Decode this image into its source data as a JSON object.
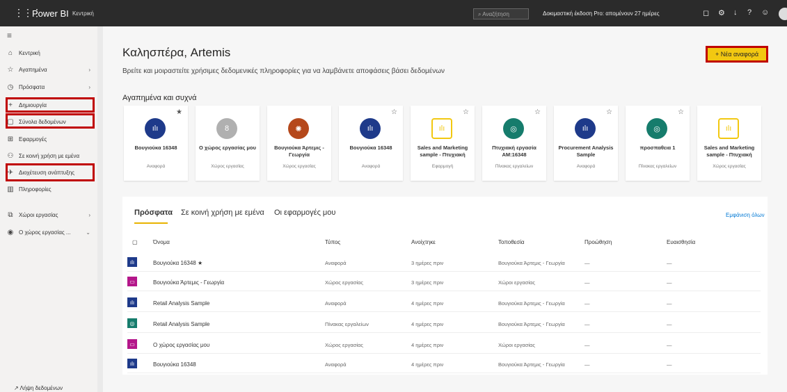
{
  "topbar": {
    "brand": "Power BI",
    "breadcrumb": "Κεντρική",
    "search_placeholder": "Αναζήτηση",
    "trial": "Δοκιμαστική έκδοση Pro: απομένουν 27 ημέρες"
  },
  "sidebar": {
    "items": [
      {
        "label": "Κεντρική"
      },
      {
        "label": "Αγαπημένα"
      },
      {
        "label": "Πρόσφατα"
      },
      {
        "label": "Δημιουργία"
      },
      {
        "label": "Σύνολα δεδομένων"
      },
      {
        "label": "Εφαρμογές"
      },
      {
        "label": "Σε κοινή χρήση με εμένα"
      },
      {
        "label": "Διοχέτευση ανάπτυξης"
      },
      {
        "label": "Πληροφορίες"
      },
      {
        "label": "Χώροι εργασίας"
      },
      {
        "label": "Ο χώρος εργασίας ..."
      }
    ],
    "footer": "Λήψη δεδομένων"
  },
  "main": {
    "greeting": "Καλησπέρα, Artemis",
    "subtitle": "Βρείτε και μοιραστείτε χρήσιμες δεδομενικές πληροφορίες για να λαμβάνετε αποφάσεις βάσει δεδομένων",
    "new_report": "Νέα αναφορά",
    "favorites_title": "Αγαπημένα και συχνά",
    "cards": [
      {
        "title": "Βουγιούκα 16348",
        "type": "Αναφορά",
        "color": "#1e3a8a"
      },
      {
        "title": "Ο χώρος εργασίας μου",
        "type": "Χώρος εργασίας",
        "color": "#b0b0b0"
      },
      {
        "title": "Βουγιούκα Άρτεμις - Γεωργία",
        "type": "Χώρος εργασίας",
        "color": "#b5481b"
      },
      {
        "title": "Βουγιούκα 16348",
        "type": "Αναφορά",
        "color": "#1e3a8a"
      },
      {
        "title": "Sales and Marketing sample - Πτυχιακή",
        "type": "Εφαρμογή",
        "color": "#f2c811"
      },
      {
        "title": "Πτυχιακή εργασία AM:16348",
        "type": "Πίνακας εργαλείων",
        "color": "#167c6c"
      },
      {
        "title": "Procurement Analysis Sample",
        "type": "Αναφορά",
        "color": "#1e3a8a"
      },
      {
        "title": "προσπαθεια 1",
        "type": "Πίνακας εργαλείων",
        "color": "#167c6c"
      },
      {
        "title": "Sales and Marketing sample - Πτυχιακή",
        "type": "Χώρος εργασίας",
        "color": "#f2c811"
      }
    ],
    "tabs": [
      "Πρόσφατα",
      "Σε κοινή χρήση με εμένα",
      "Οι εφαρμογές μου"
    ],
    "show_all": "Εμφάνιση όλων",
    "columns": [
      "Όνομα",
      "Τύπος",
      "Ανοίχτηκε",
      "Τοποθεσία",
      "Προώθηση",
      "Ευαισθησία"
    ],
    "rows": [
      {
        "name": "Βουγιούκα 16348",
        "type": "Αναφορά",
        "opened": "3 ημέρες πριν",
        "location": "Βουγιούκα Άρτεμις - Γεωργία",
        "promo": "—",
        "sens": "—",
        "color": "#1e3a8a"
      },
      {
        "name": "Βουγιούκα Άρτεμις - Γεωργία",
        "type": "Χώρος εργασίας",
        "opened": "3 ημέρες πριν",
        "location": "Χώροι εργασίας",
        "promo": "—",
        "sens": "—",
        "color": "#b4168a"
      },
      {
        "name": "Retail Analysis Sample",
        "type": "Αναφορά",
        "opened": "4 ημέρες πριν",
        "location": "Βουγιούκα Άρτεμις - Γεωργία",
        "promo": "—",
        "sens": "—",
        "color": "#1e3a8a"
      },
      {
        "name": "Retail Analysis Sample",
        "type": "Πίνακας εργαλείων",
        "opened": "4 ημέρες πριν",
        "location": "Βουγιούκα Άρτεμις - Γεωργία",
        "promo": "—",
        "sens": "—",
        "color": "#167c6c"
      },
      {
        "name": "Ο χώρος εργασίας μου",
        "type": "Χώρος εργασίας",
        "opened": "4 ημέρες πριν",
        "location": "Χώροι εργασίας",
        "promo": "—",
        "sens": "—",
        "color": "#b4168a"
      },
      {
        "name": "Βουγιούκα 16348",
        "type": "Αναφορά",
        "opened": "4 ημέρες πριν",
        "location": "Βουγιούκα Άρτεμις - Γεωργία",
        "promo": "—",
        "sens": "—",
        "color": "#1e3a8a"
      }
    ]
  }
}
